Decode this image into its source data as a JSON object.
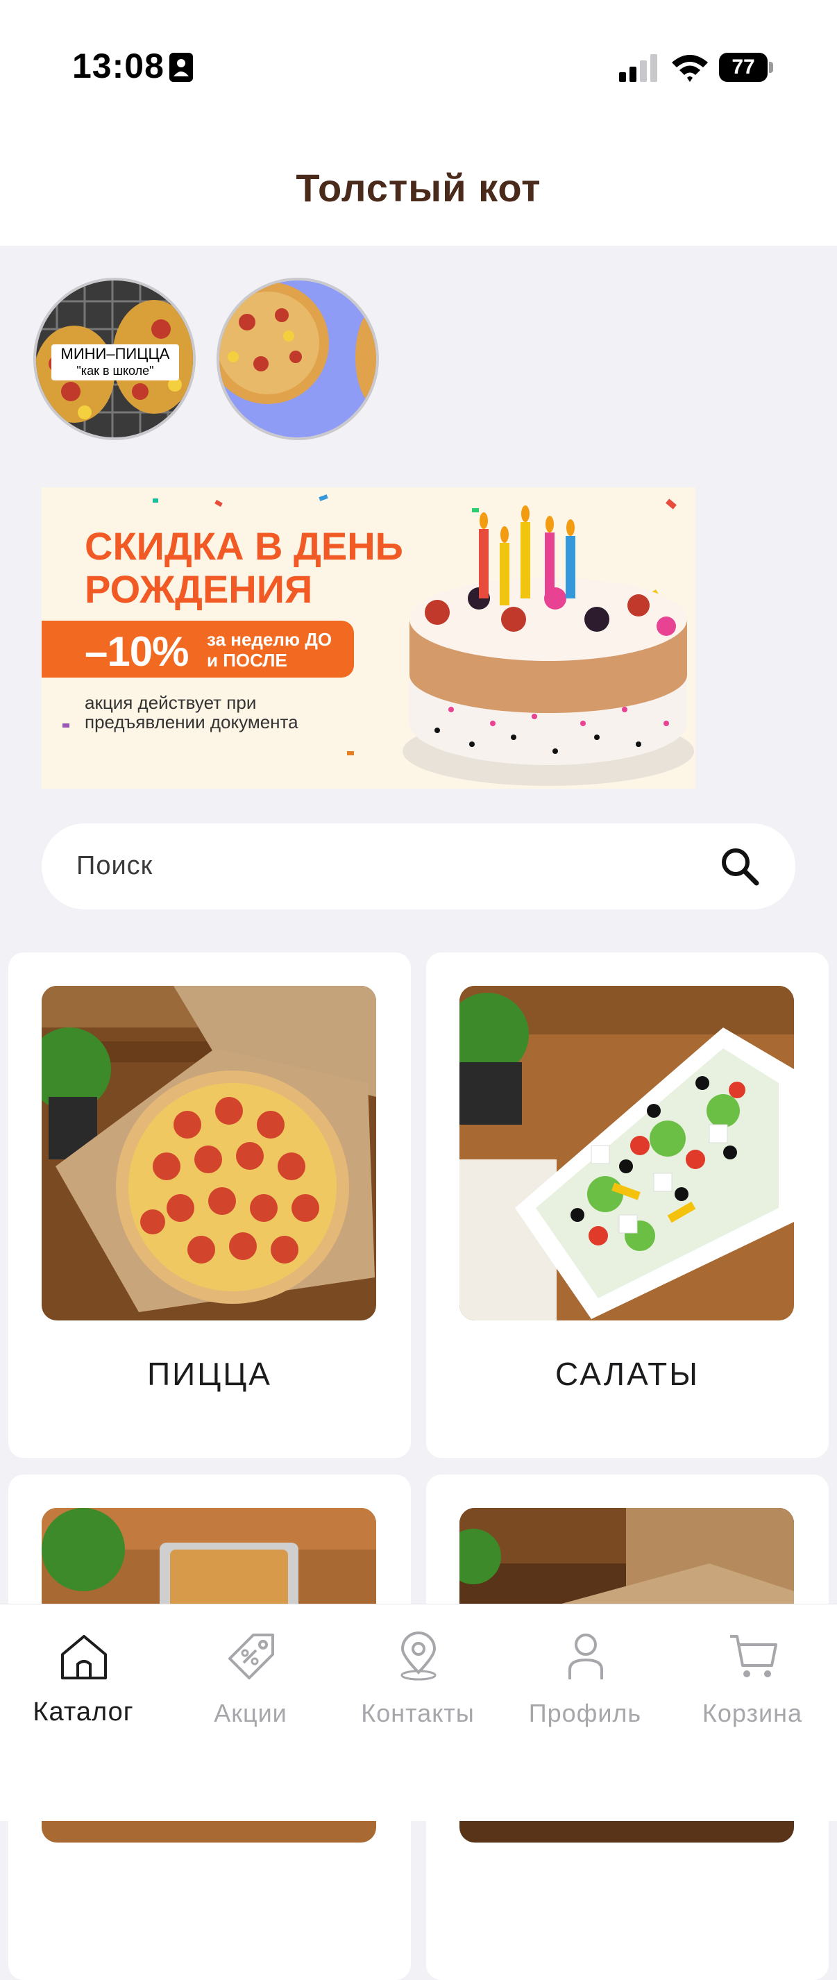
{
  "status_bar": {
    "time": "13:08",
    "battery": "77"
  },
  "header": {
    "title": "Толстый кот"
  },
  "stories": [
    {
      "label_line1": "МИНИ–ПИЦЦА",
      "label_line2": "\"как в школе\""
    },
    {
      "label_line1": "",
      "label_line2": ""
    }
  ],
  "promo": {
    "title": "СКИДКА В ДЕНЬ РОЖДЕНИЯ",
    "discount": "–10%",
    "discount_when": "за неделю ДО и ПОСЛЕ",
    "note": "акция действует при предъявлении документа"
  },
  "search": {
    "placeholder": "Поиск"
  },
  "categories": [
    {
      "label": "ПИЦЦА",
      "icon": "pizza-image"
    },
    {
      "label": "САЛАТЫ",
      "icon": "salad-image"
    },
    {
      "label": "",
      "icon": "pasta-image"
    },
    {
      "label": "",
      "icon": "box-image"
    }
  ],
  "tabbar": {
    "items": [
      {
        "label": "Каталог",
        "icon": "home-icon",
        "active": true
      },
      {
        "label": "Акции",
        "icon": "tag-icon",
        "active": false
      },
      {
        "label": "Контакты",
        "icon": "location-pin-icon",
        "active": false
      },
      {
        "label": "Профиль",
        "icon": "person-icon",
        "active": false
      },
      {
        "label": "Корзина",
        "icon": "cart-icon",
        "active": false
      }
    ]
  },
  "colors": {
    "brand_title": "#4a2a1b",
    "promo_orange": "#f26a21",
    "background": "#f1f1f6",
    "inactive_tab": "#a6a6ab"
  }
}
